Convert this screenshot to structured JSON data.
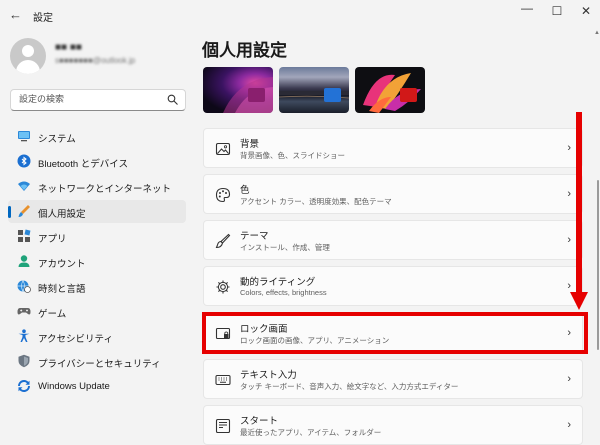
{
  "window": {
    "title": "設定",
    "back_icon": "←",
    "minimize": "—",
    "maximize": "☐",
    "close": "✕"
  },
  "profile": {
    "name": "■■ ■■",
    "email": "s■■■■■■■@outlook.jp"
  },
  "search": {
    "placeholder": "設定の検索"
  },
  "nav": {
    "items": [
      {
        "label": "システム",
        "icon": "monitor-icon"
      },
      {
        "label": "Bluetooth とデバイス",
        "icon": "bluetooth-icon"
      },
      {
        "label": "ネットワークとインターネット",
        "icon": "wifi-icon"
      },
      {
        "label": "個人用設定",
        "icon": "brush-icon",
        "selected": true
      },
      {
        "label": "アプリ",
        "icon": "apps-icon"
      },
      {
        "label": "アカウント",
        "icon": "person-icon"
      },
      {
        "label": "時刻と言語",
        "icon": "globe-clock-icon"
      },
      {
        "label": "ゲーム",
        "icon": "gamepad-icon"
      },
      {
        "label": "アクセシビリティ",
        "icon": "accessibility-icon"
      },
      {
        "label": "プライバシーとセキュリティ",
        "icon": "shield-icon"
      },
      {
        "label": "Windows Update",
        "icon": "update-icon"
      }
    ]
  },
  "main": {
    "title": "個人用設定",
    "theme_thumbnails": [
      {
        "name": "windows-bloom-dark",
        "accent": "#8a1f6e"
      },
      {
        "name": "lake-sunset",
        "accent": "#2372d6"
      },
      {
        "name": "flower-dark",
        "accent": "#d11818"
      }
    ],
    "cards": [
      {
        "title": "背景",
        "subtitle": "背景画像、色、スライドショー",
        "icon": "picture-icon"
      },
      {
        "title": "色",
        "subtitle": "アクセント カラー、透明度効果、配色テーマ",
        "icon": "palette-icon"
      },
      {
        "title": "テーマ",
        "subtitle": "インストール、作成、管理",
        "icon": "brush-icon"
      },
      {
        "title": "動的ライティング",
        "subtitle": "Colors, effects, brightness",
        "icon": "lighting-gear-icon"
      },
      {
        "title": "ロック画面",
        "subtitle": "ロック画面の画像、アプリ、アニメーション",
        "icon": "lock-screen-icon"
      },
      {
        "title": "テキスト入力",
        "subtitle": "タッチ キーボード、音声入力、絵文字など、入力方式エディター",
        "icon": "keyboard-icon"
      },
      {
        "title": "スタート",
        "subtitle": "最近使ったアプリ、アイテム、フォルダー",
        "icon": "start-icon"
      }
    ],
    "chevron": "›"
  },
  "annotation": {
    "highlight_color": "#e60000",
    "highlighted_card": "ロック画面"
  }
}
